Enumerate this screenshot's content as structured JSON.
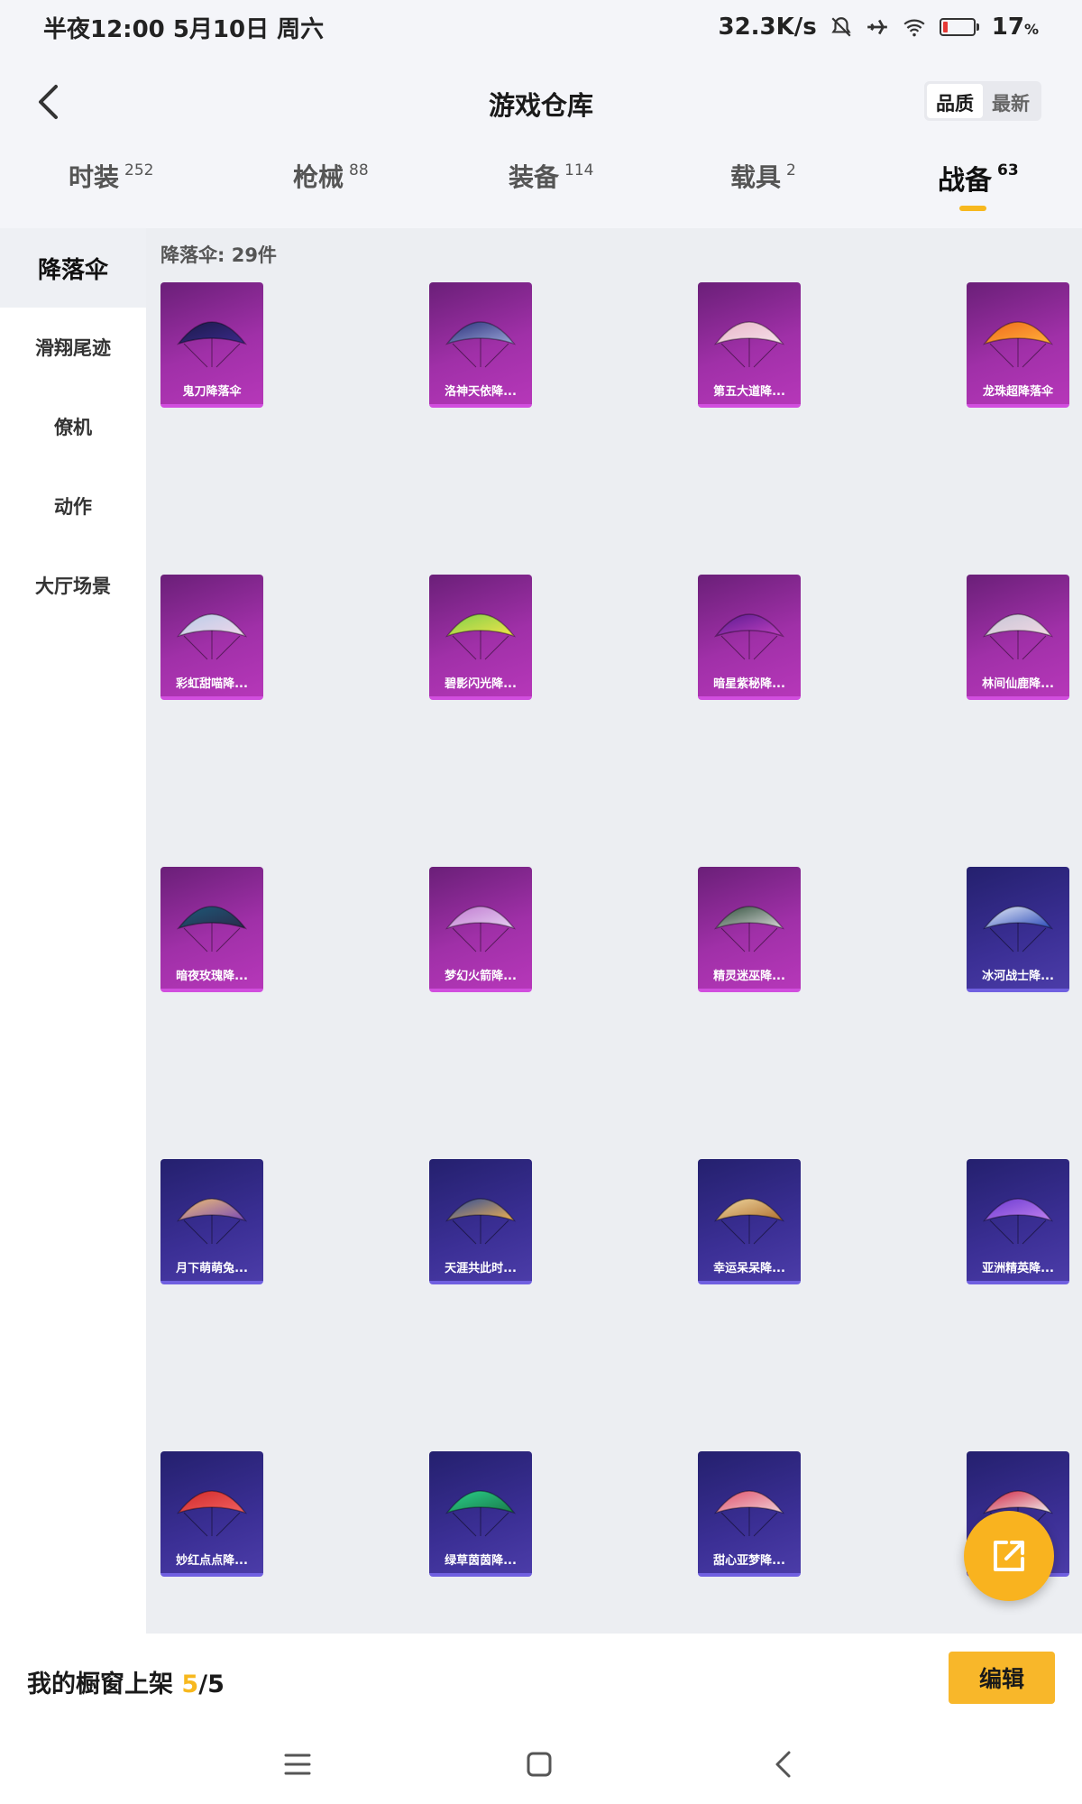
{
  "status_bar": {
    "time": "半夜12:00 5月10日 周六",
    "network_speed": "32.3K/s",
    "battery_percent": "17",
    "battery_unit": "%",
    "battery_level": 0.17
  },
  "header": {
    "title": "游戏仓库",
    "sort_options": [
      "品质",
      "最新"
    ]
  },
  "tabs": [
    {
      "label": "时装",
      "count": "252"
    },
    {
      "label": "枪械",
      "count": "88"
    },
    {
      "label": "装备",
      "count": "114"
    },
    {
      "label": "载具",
      "count": "2"
    },
    {
      "label": "战备",
      "count": "63"
    }
  ],
  "sidebar": {
    "items": [
      "降落伞",
      "滑翔尾迹",
      "僚机",
      "动作",
      "大厅场景"
    ]
  },
  "content": {
    "count_label": "降落伞: 29件",
    "items": [
      {
        "name": "鬼刀降落伞",
        "rarity": "purple"
      },
      {
        "name": "洛神天依降...",
        "rarity": "purple"
      },
      {
        "name": "第五大道降...",
        "rarity": "purple"
      },
      {
        "name": "龙珠超降落伞",
        "rarity": "purple"
      },
      {
        "name": "彩虹甜喵降...",
        "rarity": "purple"
      },
      {
        "name": "碧影闪光降...",
        "rarity": "purple"
      },
      {
        "name": "暗星紫秘降...",
        "rarity": "purple"
      },
      {
        "name": "林间仙鹿降...",
        "rarity": "purple"
      },
      {
        "name": "暗夜玫瑰降...",
        "rarity": "purple"
      },
      {
        "name": "梦幻火箭降...",
        "rarity": "purple"
      },
      {
        "name": "精灵迷巫降...",
        "rarity": "purple"
      },
      {
        "name": "冰河战士降...",
        "rarity": "indigo"
      },
      {
        "name": "月下萌萌兔...",
        "rarity": "indigo"
      },
      {
        "name": "天涯共此时...",
        "rarity": "indigo"
      },
      {
        "name": "幸运呆呆降...",
        "rarity": "indigo"
      },
      {
        "name": "亚洲精英降...",
        "rarity": "indigo"
      },
      {
        "name": "妙红点点降...",
        "rarity": "indigo"
      },
      {
        "name": "绿草茵茵降...",
        "rarity": "indigo"
      },
      {
        "name": "甜心亚梦降...",
        "rarity": "indigo"
      },
      {
        "name": "",
        "rarity": "indigo"
      }
    ]
  },
  "bottom_bar": {
    "showcase_label": "我的橱窗上架 ",
    "showcase_used": "5",
    "showcase_total": "/5",
    "edit_label": "编辑"
  },
  "colors": {
    "accent": "#f7b81e",
    "purple_card": "#a030a8",
    "indigo_card": "#3b2f95"
  },
  "icons": {
    "back": "chevron-left-icon",
    "fab": "share-external-icon",
    "nav": [
      "menu-icon",
      "home-square-icon",
      "back-triangle-icon"
    ]
  }
}
